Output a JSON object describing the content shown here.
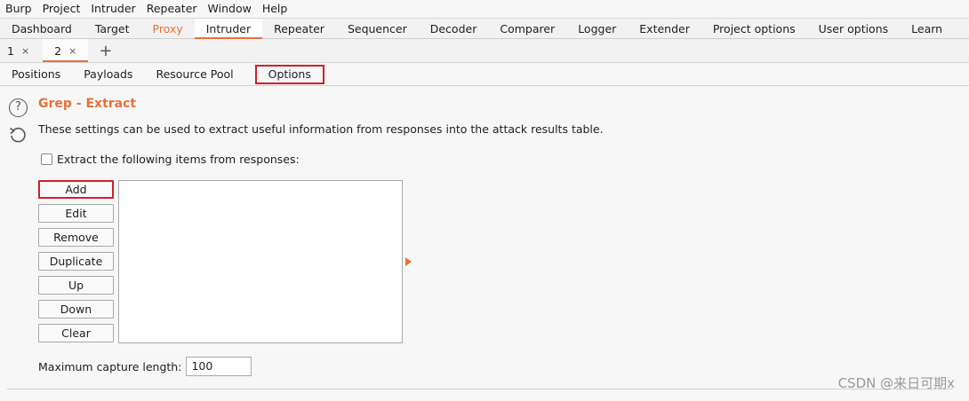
{
  "menu": [
    "Burp",
    "Project",
    "Intruder",
    "Repeater",
    "Window",
    "Help"
  ],
  "main_tabs": [
    "Dashboard",
    "Target",
    "Proxy",
    "Intruder",
    "Repeater",
    "Sequencer",
    "Decoder",
    "Comparer",
    "Logger",
    "Extender",
    "Project options",
    "User options",
    "Learn"
  ],
  "sub_tabs": {
    "tab1": "1",
    "tab2": "2",
    "close": "×",
    "add": "+"
  },
  "inner_tabs": [
    "Positions",
    "Payloads",
    "Resource Pool",
    "Options"
  ],
  "section": {
    "help": "?",
    "title": "Grep - Extract",
    "description": "These settings can be used to extract useful information from responses into the attack results table.",
    "checkbox_label": "Extract the following items from responses:"
  },
  "buttons": {
    "add": "Add",
    "edit": "Edit",
    "remove": "Remove",
    "duplicate": "Duplicate",
    "up": "Up",
    "down": "Down",
    "clear": "Clear"
  },
  "capture": {
    "label": "Maximum capture length:",
    "value": "100"
  },
  "watermark": "CSDN @来日可期x",
  "colors": {
    "accent": "#e8703a",
    "highlight_box": "#d0202a"
  }
}
